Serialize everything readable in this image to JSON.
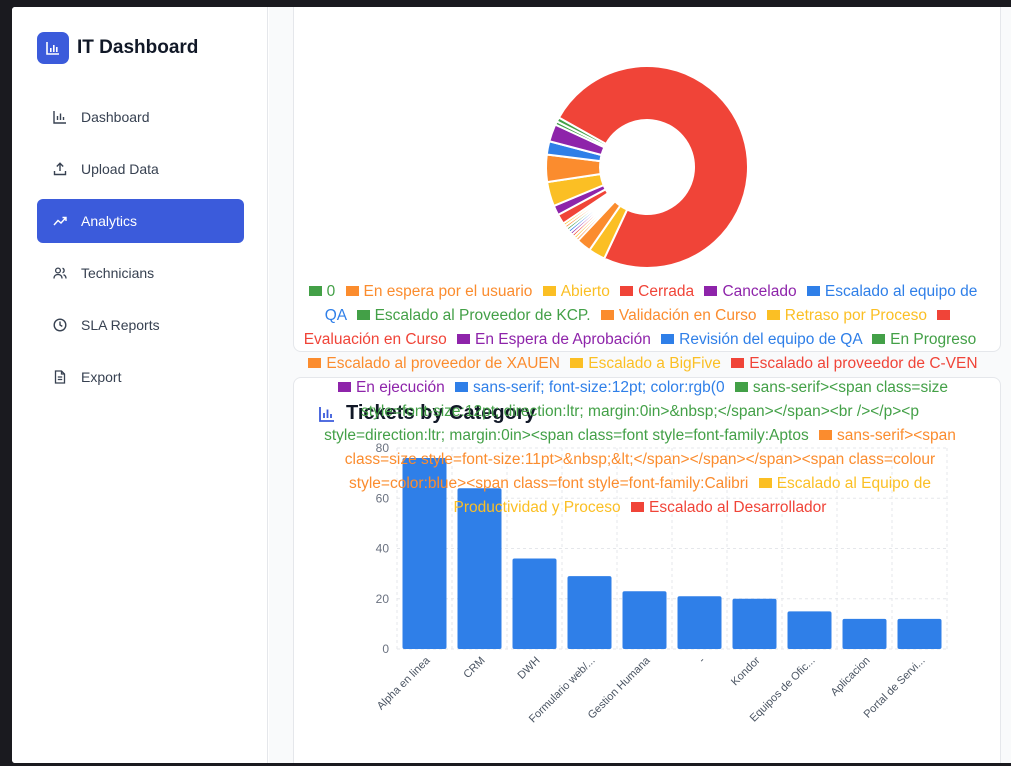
{
  "app": {
    "title": "IT Dashboard"
  },
  "sidebar": {
    "items": [
      {
        "label": "Dashboard",
        "icon": "bar-chart-icon",
        "active": false
      },
      {
        "label": "Upload Data",
        "icon": "upload-icon",
        "active": false
      },
      {
        "label": "Analytics",
        "icon": "trending-up-icon",
        "active": true
      },
      {
        "label": "Technicians",
        "icon": "users-icon",
        "active": false
      },
      {
        "label": "SLA Reports",
        "icon": "clock-icon",
        "active": false
      },
      {
        "label": "Export",
        "icon": "file-text-icon",
        "active": false
      }
    ]
  },
  "colors": {
    "accent": "#3b5bdb",
    "green": "#43a047",
    "orange": "#fb8c2e",
    "yellow": "#fbbf24",
    "red": "#f04438",
    "purple": "#8e24aa",
    "blue": "#2f7fe8"
  },
  "status_chart": {
    "legend": [
      {
        "label": "0",
        "color": "#43a047"
      },
      {
        "label": "En espera por el usuario",
        "color": "#fb8c2e"
      },
      {
        "label": "Abierto",
        "color": "#fbbf24"
      },
      {
        "label": "Cerrada",
        "color": "#f04438"
      },
      {
        "label": "Cancelado",
        "color": "#8e24aa"
      },
      {
        "label": "Escalado al equipo de QA",
        "color": "#2f7fe8"
      },
      {
        "label": "Escalado al Proveedor de KCP.",
        "color": "#43a047"
      },
      {
        "label": "Validación en Curso",
        "color": "#fb8c2e"
      },
      {
        "label": "Retraso por Proceso",
        "color": "#fbbf24"
      },
      {
        "label": "Evaluación en Curso",
        "color": "#f04438"
      },
      {
        "label": "En Espera de Aprobación",
        "color": "#8e24aa"
      },
      {
        "label": "Revisión del equipo de QA",
        "color": "#2f7fe8"
      },
      {
        "label": "En Progreso",
        "color": "#43a047"
      },
      {
        "label": "Escalado al proveedor de XAUEN",
        "color": "#fb8c2e"
      },
      {
        "label": "Escalado a BigFive",
        "color": "#fbbf24"
      },
      {
        "label": "Escalado al proveedor de C-VEN",
        "color": "#f04438"
      },
      {
        "label": "En ejecución",
        "color": "#8e24aa"
      },
      {
        "label": "sans-serif; font-size:12pt; color:rgb(0",
        "color": "#2f7fe8"
      },
      {
        "label": "sans-serif><span class=size style=font-size:12pt; direction:ltr; margin:0in>&nbsp;</span></span><br /></p><p style=direction:ltr; margin:0in><span class=font style=font-family:Aptos",
        "color": "#43a047"
      },
      {
        "label": "sans-serif><span class=size style=font-size:11pt>&nbsp;&lt;</span></span></span><span class=colour style=color:blue><span class=font style=font-family:Calibri",
        "color": "#fb8c2e"
      },
      {
        "label": "Escalado al Equipo de Productividad y Proceso",
        "color": "#fbbf24"
      },
      {
        "label": "Escalado al Desarrollador",
        "color": "#f04438"
      }
    ]
  },
  "category_card": {
    "title": "Tickets by Category"
  },
  "chart_data": [
    {
      "type": "pie",
      "variant": "doughnut",
      "categories": [
        "Cerrada",
        "Abierto",
        "En espera por el usuario",
        "Validación en Curso",
        "Retraso por Proceso",
        "Evaluación en Curso",
        "En Espera de Aprobación",
        "Revisión del equipo de QA",
        "En Progreso",
        "Escalado al proveedor de XAUEN",
        "Escalado a BigFive",
        "Escalado al proveedor de C-VEN",
        "En ejecución",
        "Escalado al Equipo de Productividad y Proceso",
        "Escalado al Desarrollador",
        "Escalado al equipo de QA",
        "Cancelado",
        "0",
        "Escalado al Proveedor de KCP."
      ],
      "values": [
        66,
        2.4,
        2.1,
        0.4,
        0.4,
        0.4,
        0.4,
        0.4,
        0.4,
        0.4,
        0.4,
        1.4,
        1.4,
        3.5,
        3.9,
        1.9,
        2.5,
        0.5,
        0.6
      ],
      "colors": [
        "#f04438",
        "#fbbf24",
        "#fb8c2e",
        "#fb8c2e",
        "#fbbf24",
        "#f04438",
        "#8e24aa",
        "#2f7fe8",
        "#43a047",
        "#fb8c2e",
        "#fbbf24",
        "#f04438",
        "#8e24aa",
        "#fbbf24",
        "#fb8c2e",
        "#2f7fe8",
        "#8e24aa",
        "#43a047",
        "#43a047"
      ]
    },
    {
      "type": "bar",
      "categories": [
        "Alpha en linea",
        "CRM",
        "DWH",
        "Formulario web/...",
        "Gestion Humana",
        "-",
        "Kondor",
        "Equipos de Ofic...",
        "Aplicacion",
        "Portal de Servi..."
      ],
      "values": [
        76,
        64,
        36,
        29,
        23,
        21,
        20,
        15,
        12,
        12
      ],
      "yticks": [
        0,
        20,
        40,
        60,
        80
      ],
      "ylim": [
        0,
        80
      ],
      "color": "#2f7fe8",
      "grid": true
    }
  ]
}
